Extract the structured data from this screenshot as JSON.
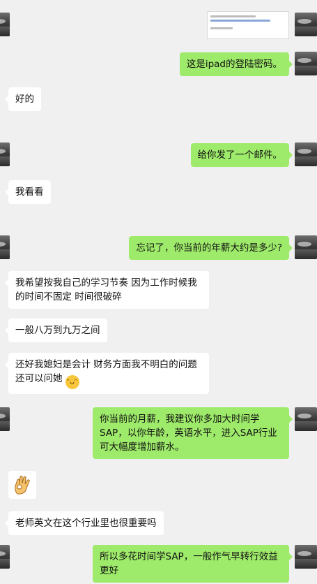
{
  "messages": [
    {
      "side": "out",
      "kind": "image"
    },
    {
      "side": "out",
      "text": "这是ipad的登陆密码。"
    },
    {
      "side": "in",
      "text": "好的"
    },
    {
      "side": "out",
      "text": "给你发了一个邮件。"
    },
    {
      "side": "in",
      "text": "我看看"
    },
    {
      "side": "out",
      "text": "忘记了，你当前的年薪大约是多少?"
    },
    {
      "side": "in",
      "lines": [
        "我希望按我自己的学习节奏 因为工作时候我",
        "的时间不固定 时间很破碎"
      ]
    },
    {
      "side": "in",
      "text": "一般八万到九万之间"
    },
    {
      "side": "in",
      "lines": [
        "还好我媳妇是会计 财务方面我不明白的问题",
        "还可以问她"
      ],
      "emoji": "grinning-face"
    },
    {
      "side": "out",
      "lines": [
        "你当前的月薪，我建议你多加大时间学",
        "SAP，以你年龄，英语水平，进入SAP行业",
        "可大幅度增加薪水。"
      ]
    },
    {
      "side": "in",
      "kind": "sticker",
      "sticker": "ok-hand"
    },
    {
      "side": "in",
      "text": "老师英文在这个行业里也很重要吗"
    },
    {
      "side": "out",
      "lines": [
        "所以多花时间学SAP，一般作气早转行效益",
        "更好"
      ]
    }
  ],
  "colors": {
    "background": "#f0f0f0",
    "incoming_bubble": "#ffffff",
    "outgoing_bubble": "#9eea6a"
  }
}
